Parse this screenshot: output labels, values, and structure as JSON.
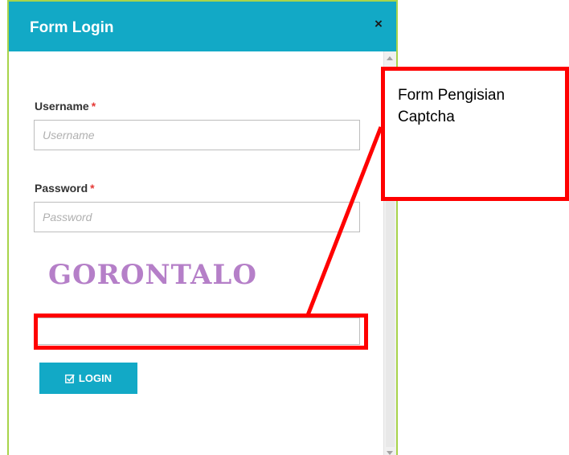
{
  "modal": {
    "title": "Form Login",
    "close_label": "×"
  },
  "form": {
    "username_label": "Username",
    "username_placeholder": "Username",
    "password_label": "Password",
    "password_placeholder": "Password",
    "required_mark": "*",
    "captcha_text": "GORONTALO",
    "captcha_value": "",
    "login_label": "LOGIN"
  },
  "annotation": {
    "callout_text": "Form Pengisian Captcha"
  },
  "colors": {
    "header": "#12a9c6",
    "button": "#12a9c6",
    "modal_border": "#a8d44a",
    "annotation": "#ff0000",
    "captcha": "#b57fc8",
    "required": "#e53935"
  },
  "icons": {
    "close": "close-icon",
    "login": "check-square-icon"
  }
}
